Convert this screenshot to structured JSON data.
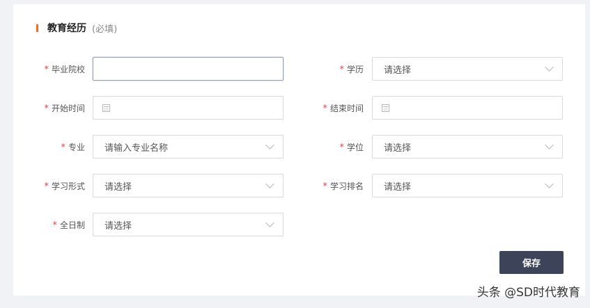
{
  "section": {
    "title": "教育经历",
    "note": "(必填)"
  },
  "required_mark": "*",
  "fields": {
    "school": {
      "label": "毕业院校",
      "value": ""
    },
    "degree_level": {
      "label": "学历",
      "value": "请选择",
      "icon": "chevron-down-icon"
    },
    "start_time": {
      "label": "开始时间",
      "value": "",
      "icon": "calendar-icon"
    },
    "end_time": {
      "label": "结束时间",
      "value": "",
      "icon": "calendar-icon"
    },
    "major": {
      "label": "专业",
      "value": "请输入专业名称",
      "icon": "chevron-down-icon"
    },
    "degree": {
      "label": "学位",
      "value": "请选择",
      "icon": "chevron-down-icon"
    },
    "study_form": {
      "label": "学习形式",
      "value": "请选择",
      "icon": "chevron-down-icon"
    },
    "ranking": {
      "label": "学习排名",
      "value": "请选择",
      "icon": "chevron-down-icon"
    },
    "full_time": {
      "label": "全日制",
      "value": "请选择",
      "icon": "chevron-down-icon"
    }
  },
  "actions": {
    "save_label": "保存"
  },
  "watermark": "头条 @SD时代教育",
  "colors": {
    "accent": "#f06e1e",
    "required": "#e64242",
    "button": "#3d4459",
    "background": "#f0f2f5"
  }
}
